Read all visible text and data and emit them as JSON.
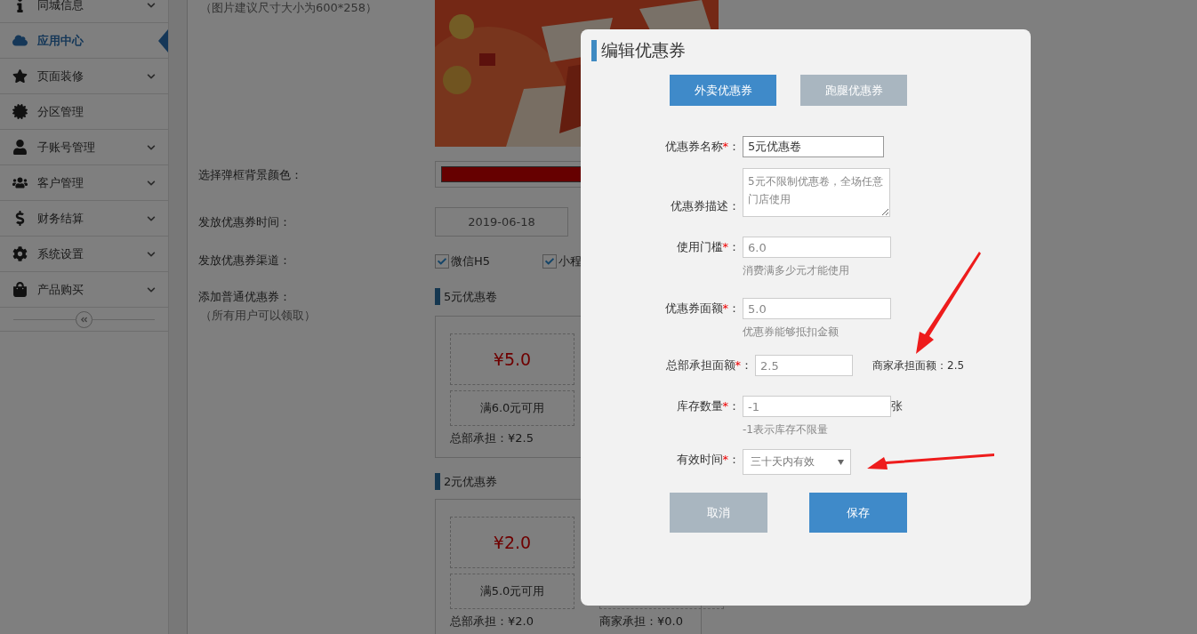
{
  "sidebar": {
    "items": [
      {
        "label": "同城信息",
        "selected": false,
        "expandable": true
      },
      {
        "label": "应用中心",
        "selected": true,
        "expandable": false
      },
      {
        "label": "页面装修",
        "selected": false,
        "expandable": true
      },
      {
        "label": "分区管理",
        "selected": false,
        "expandable": false
      },
      {
        "label": "子账号管理",
        "selected": false,
        "expandable": true
      },
      {
        "label": "客户管理",
        "selected": false,
        "expandable": true
      },
      {
        "label": "财务结算",
        "selected": false,
        "expandable": true
      },
      {
        "label": "系统设置",
        "selected": false,
        "expandable": true
      },
      {
        "label": "产品购买",
        "selected": false,
        "expandable": true
      }
    ]
  },
  "settings": {
    "image_hint": "（图片建议尺寸大小为600*258）",
    "color_label": "选择弹框背景颜色：",
    "time_label": "发放优惠券时间：",
    "start_date": "2019-06-18",
    "channel_label": "发放优惠券渠道：",
    "channels": [
      {
        "label": "微信H5",
        "checked": true
      },
      {
        "label": "小程",
        "checked": true
      }
    ],
    "coupon_label": "添加普通优惠券：",
    "coupon_hint": "（所有用户可以领取）",
    "coupon_sections": [
      {
        "title": "5元优惠卷",
        "price": "¥5.0",
        "condition": "满6.0元可用",
        "hq_share": "总部承担：¥2.5"
      },
      {
        "title": "2元优惠券",
        "price": "¥2.0",
        "condition": "满5.0元可用",
        "hq_share": "总部承担：¥2.0",
        "merchant_share": "商家承担：¥0.0"
      }
    ]
  },
  "modal": {
    "title": "编辑优惠券",
    "tabs": [
      {
        "label": "外卖优惠券",
        "selected": true
      },
      {
        "label": "跑腿优惠券",
        "selected": false
      }
    ],
    "fields": [
      {
        "kind": "text",
        "label": "优惠券名称",
        "required_mark": "*",
        "colon": "：",
        "value": "5元优惠卷"
      },
      {
        "kind": "textarea",
        "label": "优惠券描述",
        "colon": "：",
        "placeholder": "5元不限制优惠卷，全场任意门店使用"
      },
      {
        "kind": "text",
        "label": "使用门槛",
        "required_mark": "*",
        "colon": "：",
        "placeholder": "6.0",
        "hint": "消费满多少元才能使用"
      },
      {
        "kind": "text",
        "label": "优惠券面额",
        "required_mark": "*",
        "colon": "：",
        "placeholder": "5.0",
        "hint": "优惠券能够抵扣金额"
      },
      {
        "kind": "short",
        "label": "总部承担面额",
        "required_mark": "*",
        "colon": "：",
        "placeholder": "2.5",
        "note": "商家承担面额：2.5"
      },
      {
        "kind": "text",
        "label": "库存数量",
        "required_mark": "*",
        "colon": "：",
        "placeholder": "-1",
        "suffix": "张",
        "hint": "-1表示库存不限量"
      },
      {
        "kind": "select",
        "label": "有效时间",
        "required_mark": "*",
        "colon": "：",
        "value": "三十天内有效"
      }
    ],
    "buttons": [
      {
        "label": "取消",
        "kind": "secondary"
      },
      {
        "label": "保存",
        "kind": "primary"
      }
    ]
  }
}
